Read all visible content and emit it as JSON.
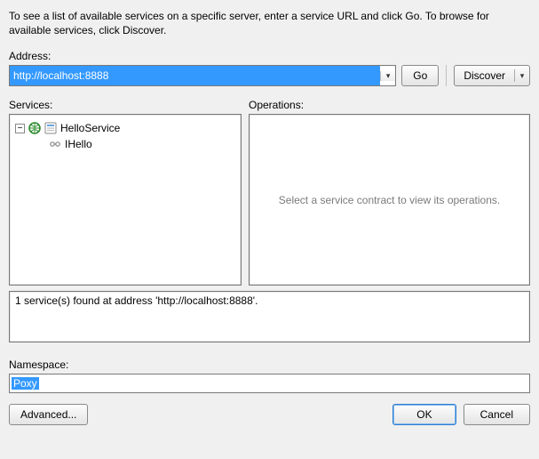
{
  "intro": "To see a list of available services on a specific server, enter a service URL and click Go. To browse for available services, click Discover.",
  "address": {
    "label": "Address:",
    "value": "http://localhost:8888",
    "go": "Go",
    "discover": "Discover"
  },
  "services": {
    "label": "Services:",
    "tree": {
      "root": {
        "name": "HelloService"
      },
      "child": {
        "name": "IHello"
      }
    }
  },
  "operations": {
    "label": "Operations:",
    "empty": "Select a service contract to view its operations."
  },
  "status": "1 service(s) found at address 'http://localhost:8888'.",
  "namespace": {
    "label": "Namespace:",
    "value": "Poxy"
  },
  "buttons": {
    "advanced": "Advanced...",
    "ok": "OK",
    "cancel": "Cancel"
  }
}
